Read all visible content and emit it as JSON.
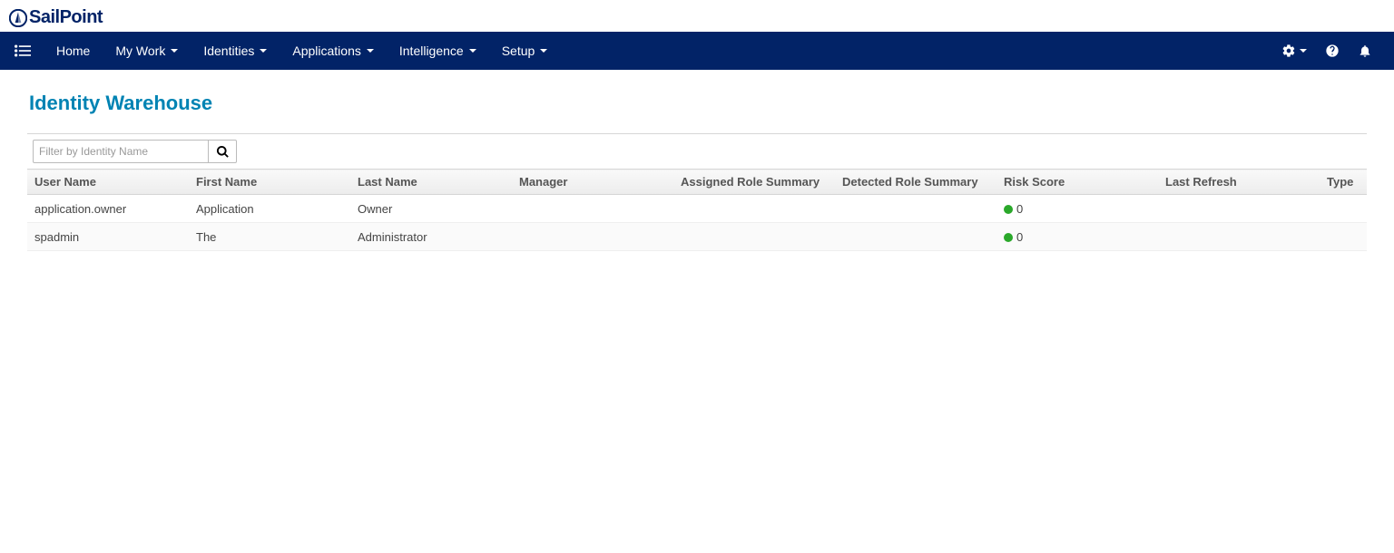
{
  "brand": "SailPoint",
  "nav": {
    "items": [
      {
        "label": "Home",
        "dropdown": false
      },
      {
        "label": "My Work",
        "dropdown": true
      },
      {
        "label": "Identities",
        "dropdown": true
      },
      {
        "label": "Applications",
        "dropdown": true
      },
      {
        "label": "Intelligence",
        "dropdown": true
      },
      {
        "label": "Setup",
        "dropdown": true
      }
    ]
  },
  "page": {
    "title": "Identity Warehouse",
    "filter_placeholder": "Filter by Identity Name"
  },
  "table": {
    "columns": [
      "User Name",
      "First Name",
      "Last Name",
      "Manager",
      "Assigned Role Summary",
      "Detected Role Summary",
      "Risk Score",
      "Last Refresh",
      "Type"
    ],
    "rows": [
      {
        "user_name": "application.owner",
        "first_name": "Application",
        "last_name": "Owner",
        "manager": "",
        "assigned_role_summary": "",
        "detected_role_summary": "",
        "risk_score": "0",
        "risk_color": "#2aa82a",
        "last_refresh": "",
        "type": ""
      },
      {
        "user_name": "spadmin",
        "first_name": "The",
        "last_name": "Administrator",
        "manager": "",
        "assigned_role_summary": "",
        "detected_role_summary": "",
        "risk_score": "0",
        "risk_color": "#2aa82a",
        "last_refresh": "",
        "type": ""
      }
    ]
  }
}
